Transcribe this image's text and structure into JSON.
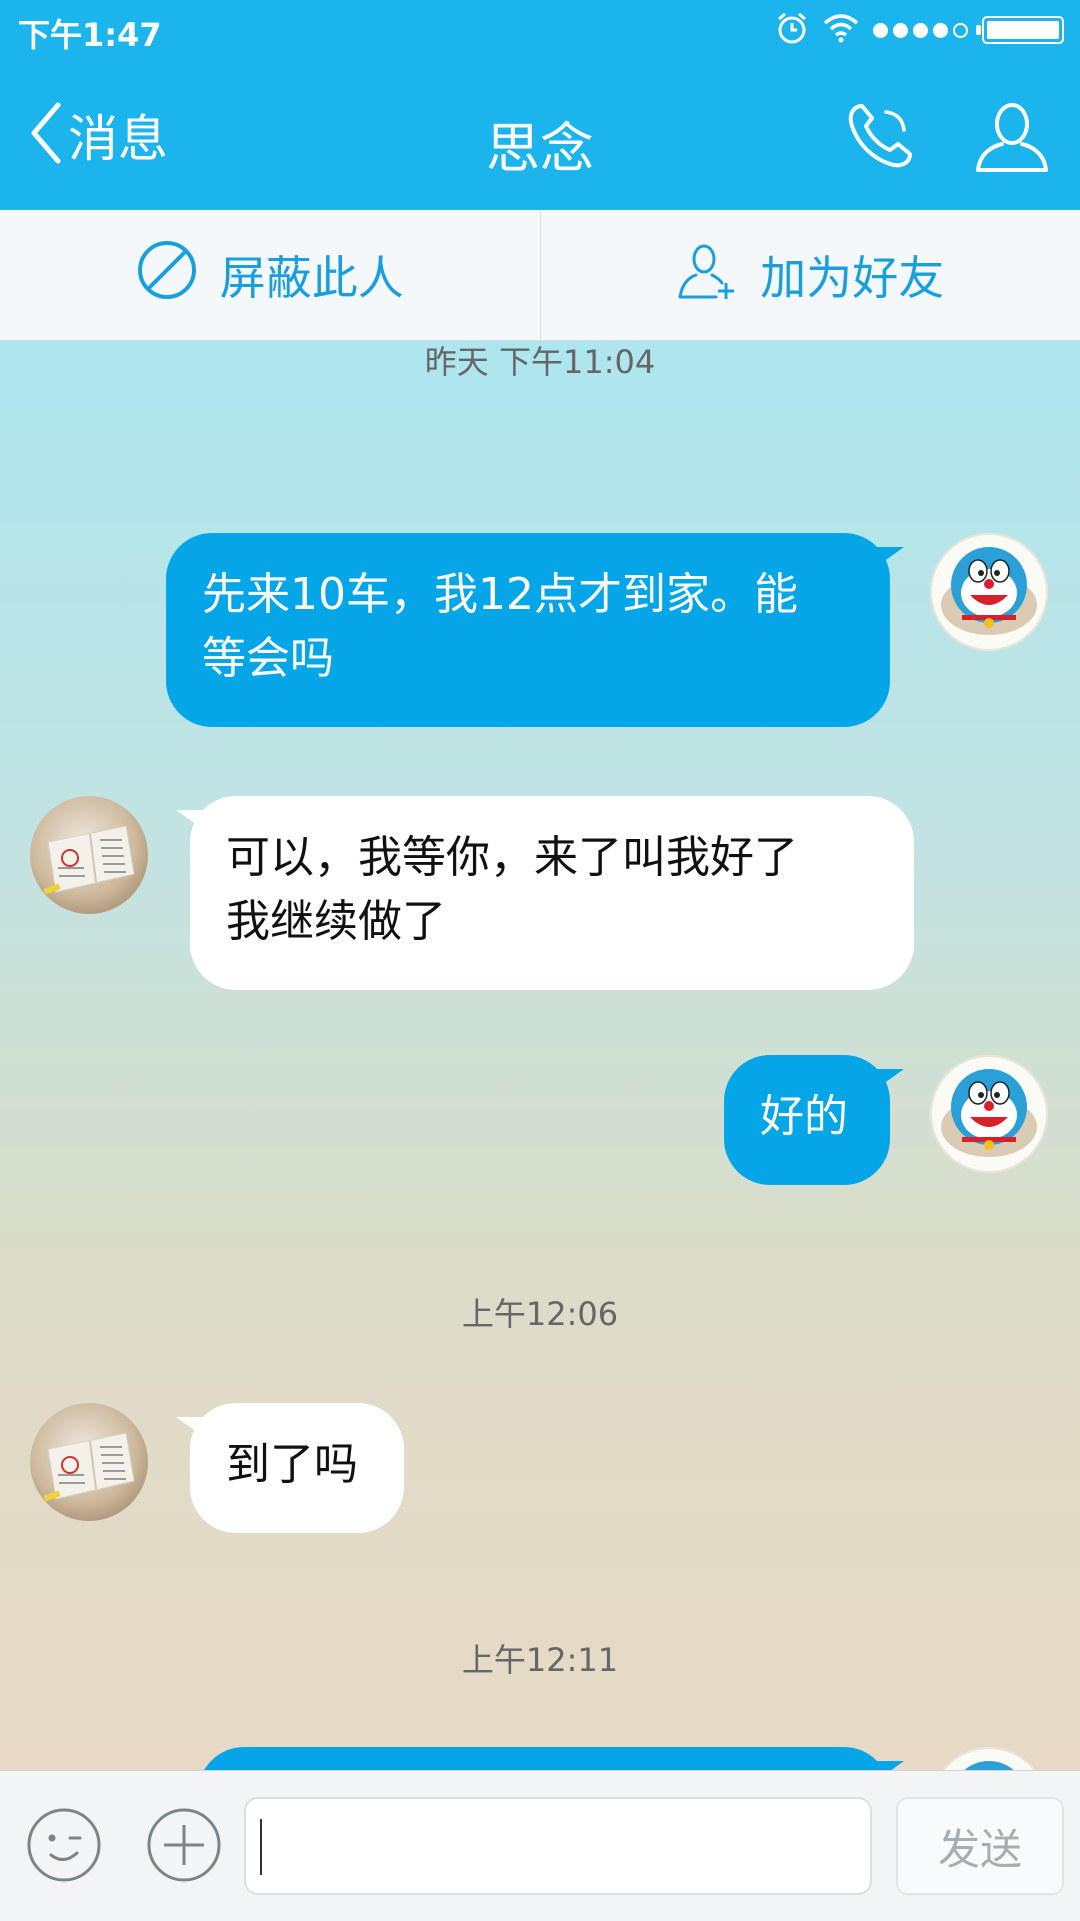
{
  "status_bar": {
    "time": "下午1:47"
  },
  "nav": {
    "back_label": "消息",
    "title": "思念"
  },
  "actions": {
    "block_label": "屏蔽此人",
    "add_friend_label": "加为好友"
  },
  "chat": {
    "timestamps": [
      "昨天 下午11:04",
      "上午12:06",
      "上午12:11"
    ],
    "messages": [
      {
        "direction": "out",
        "lines": [
          "先来10车，我12点才到家。能",
          "等会吗"
        ]
      },
      {
        "direction": "in",
        "lines": [
          "可以，我等你，来了叫我好了",
          "我继续做了"
        ]
      },
      {
        "direction": "out",
        "lines": [
          "好的"
        ]
      },
      {
        "direction": "in",
        "lines": [
          "到了吗"
        ]
      },
      {
        "direction": "out",
        "lines": [
          ""
        ]
      }
    ]
  },
  "composer": {
    "input_value": "",
    "send_label": "发送"
  },
  "colors": {
    "accent": "#1bb4ec",
    "outgoing_bubble": "#04a6e8",
    "incoming_bubble": "#ffffff"
  },
  "icons": [
    "alarm-icon",
    "wifi-icon",
    "signal-icon",
    "battery-icon",
    "back-chevron-icon",
    "phone-icon",
    "profile-icon",
    "block-icon",
    "add-friend-icon",
    "emoji-icon",
    "plus-icon"
  ]
}
